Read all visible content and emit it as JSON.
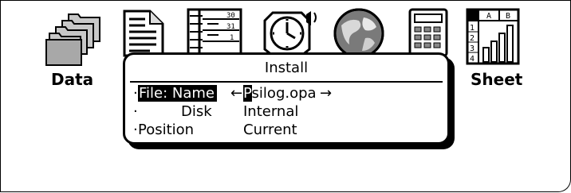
{
  "desktop": {
    "icons": [
      {
        "name": "data",
        "label": "Data"
      },
      {
        "name": "word",
        "label": ""
      },
      {
        "name": "agenda",
        "label": ""
      },
      {
        "name": "time",
        "label": ""
      },
      {
        "name": "world",
        "label": ""
      },
      {
        "name": "calc",
        "label": ""
      },
      {
        "name": "sheet",
        "label": "Sheet"
      }
    ],
    "agenda_numbers": [
      "30",
      "31",
      "1"
    ],
    "sheet_headers": [
      "A",
      "B"
    ],
    "sheet_rows": [
      "1",
      "2",
      "3",
      "4"
    ]
  },
  "dialog": {
    "title": "Install",
    "fields": [
      {
        "label": "File: Name",
        "value_prefix": "P",
        "value_rest": "silog.opa",
        "left_arrow": "←",
        "right_arrow": "→"
      },
      {
        "label": "Disk",
        "value": "Internal"
      },
      {
        "label": "Position",
        "value": "Current"
      }
    ],
    "bullet": "·"
  }
}
